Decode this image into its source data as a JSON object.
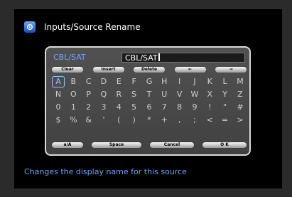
{
  "header": {
    "title": "Inputs/Source Rename",
    "icon": "settings-icon"
  },
  "input": {
    "label": "CBL/SAT",
    "value": "CBL/SAT"
  },
  "function_buttons": [
    "Clear",
    "Insert",
    "Delete",
    "←",
    "→"
  ],
  "keyboard": {
    "selected": "A",
    "rows": [
      [
        "A",
        "B",
        "C",
        "D",
        "E",
        "F",
        "G",
        "H",
        "I",
        "J",
        "K",
        "L",
        "M"
      ],
      [
        "N",
        "O",
        "P",
        "Q",
        "R",
        "S",
        "T",
        "U",
        "V",
        "W",
        "X",
        "Y",
        "Z"
      ],
      [
        "0",
        "1",
        "2",
        "3",
        "4",
        "5",
        "6",
        "7",
        "8",
        "9",
        "!",
        "\"",
        "#"
      ],
      [
        "$",
        "%",
        "&",
        "'",
        "(",
        ")",
        "*",
        "+",
        ",",
        ";",
        "<",
        "=",
        ">"
      ]
    ]
  },
  "bottom_buttons": {
    "case_toggle": "a/A",
    "space": "Space",
    "cancel": "Cancel",
    "ok": "O K"
  },
  "help_text": "Changes the display name for this source",
  "colors": {
    "accent": "#6fa2ff",
    "panel": "#4a4a4a",
    "background": "#000000"
  }
}
